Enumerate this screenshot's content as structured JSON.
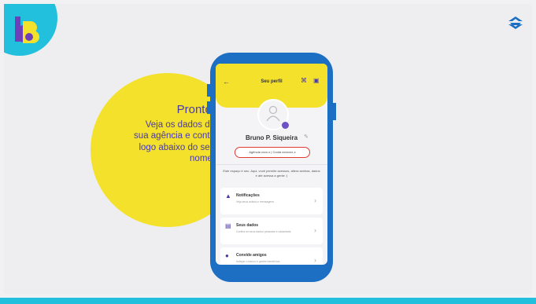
{
  "brand": {
    "logo_color_primary": "#6e3fb8",
    "logo_color_secondary": "#f3e12b",
    "accent_cyan": "#22c0dd",
    "accent_yellow": "#f3e12b",
    "bank_icon": "banco-do-brasil-icon"
  },
  "speech": {
    "title": "Pronto!",
    "lines": [
      "Veja os dados da",
      "sua agência  e conta",
      "logo abaixo  do seu",
      "nome."
    ]
  },
  "phone": {
    "header": {
      "back_icon": "arrow-left-icon",
      "title": "Seu perfil",
      "icon_1": "qr-code-icon",
      "icon_2": "card-icon"
    },
    "profile": {
      "name": "Bruno P. Siqueira",
      "account_line": "Agência xxxx-x | Conta xxxxxxx-x"
    },
    "intro": "Este espaço é seu. Aqui, você permite acessos, altera senhas, dados e até acessa a gente :)",
    "cards": [
      {
        "icon": "bell-icon",
        "title": "Notificações",
        "desc": "Veja seus avisos e mensagens"
      },
      {
        "icon": "document-icon",
        "title": "Seus dados",
        "desc": "Confira os seus dados pessoais e cadastrais"
      },
      {
        "icon": "users-icon",
        "title": "Convide amigos",
        "desc": "Indique o banco e ganhe benefícios"
      }
    ]
  }
}
